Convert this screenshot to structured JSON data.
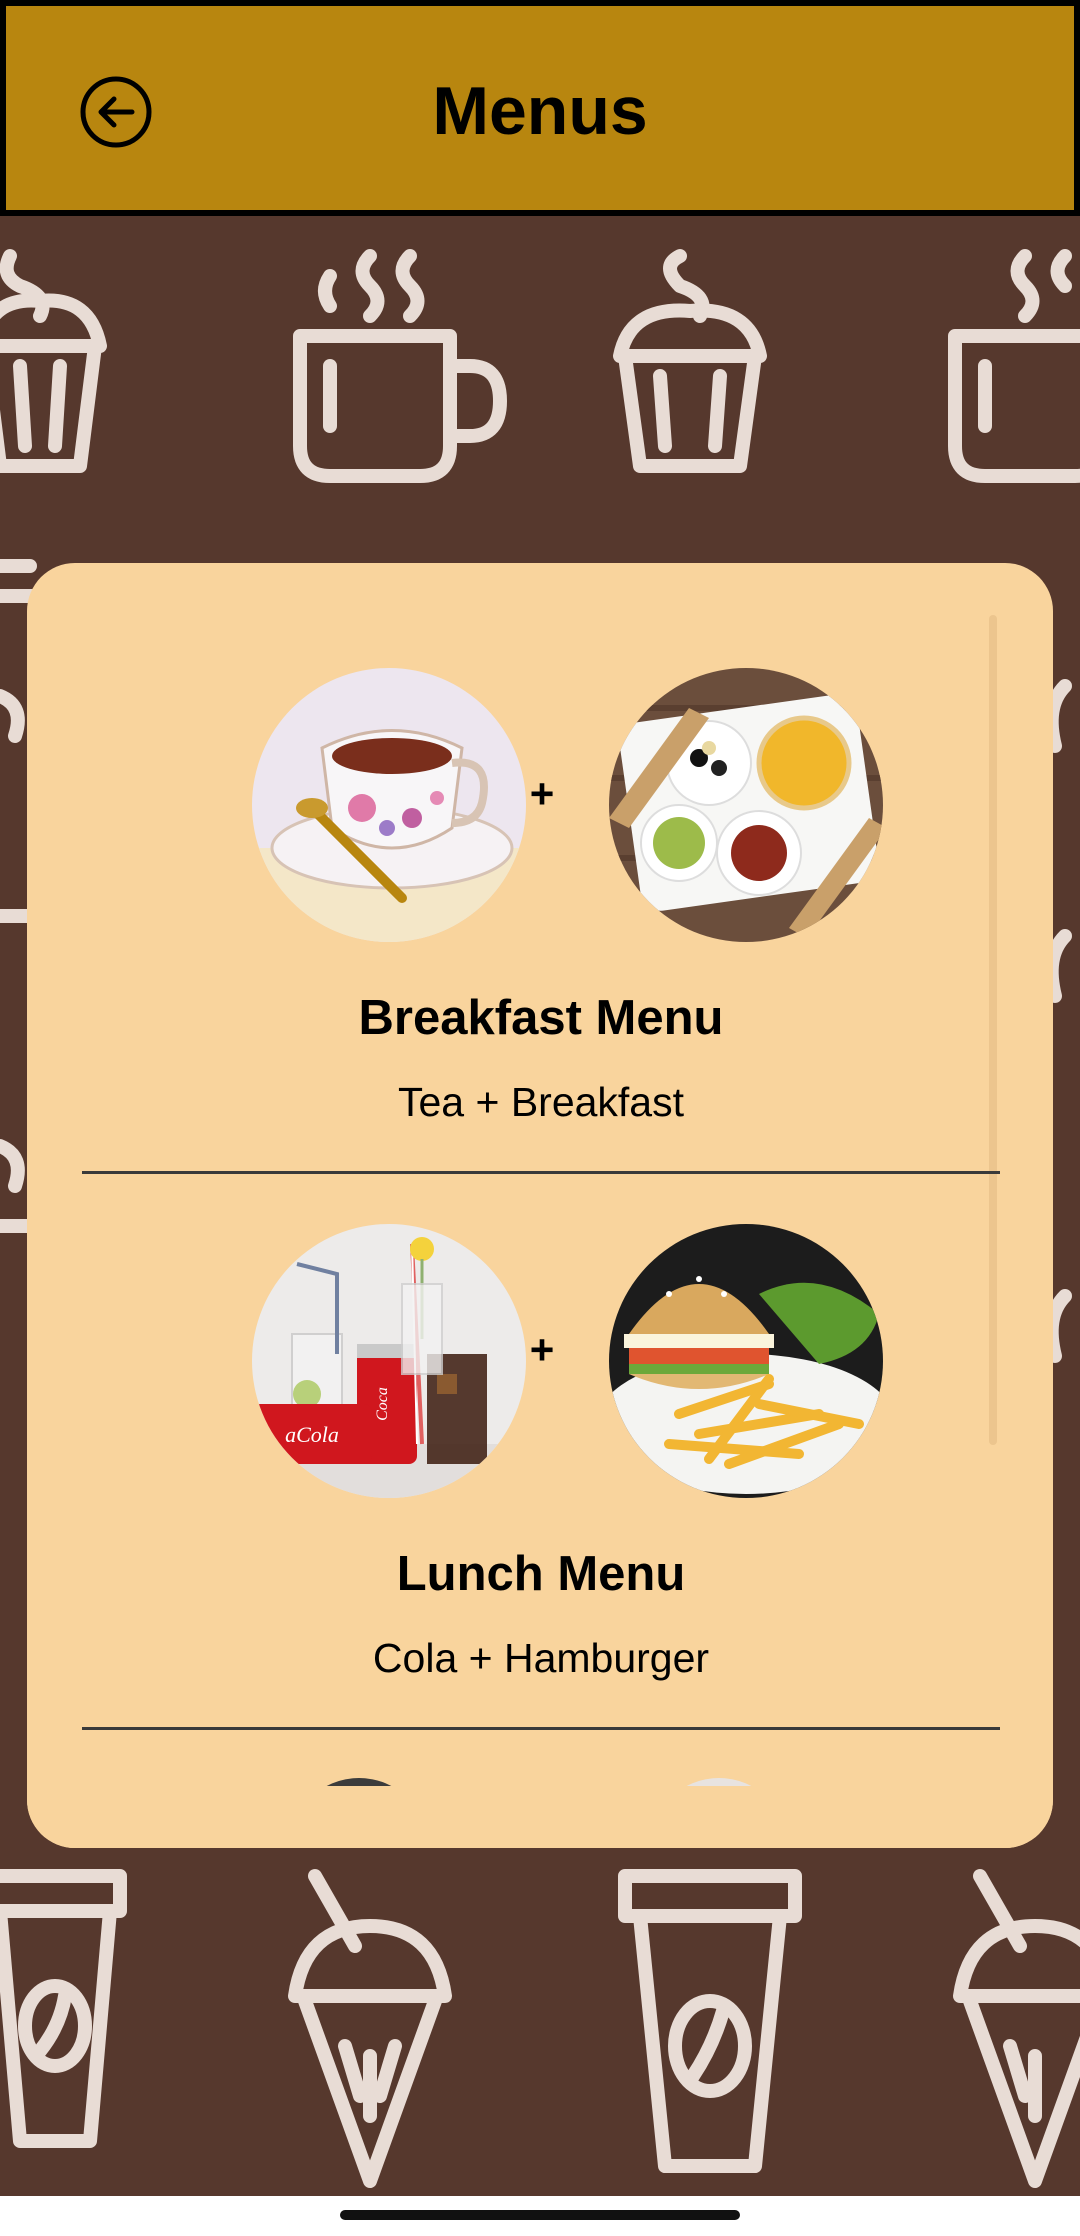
{
  "app_bar": {
    "title": "Menus",
    "back_icon": "arrow-left-circle-icon"
  },
  "colors": {
    "app_bar": "#B8860F",
    "background": "#56382D",
    "card": "#F9D49D",
    "pattern": "#E8DCD5"
  },
  "menus": [
    {
      "title": "Breakfast Menu",
      "subtitle": "Tea + Breakfast",
      "left_image": "tea-cup-photo",
      "right_image": "breakfast-plate-photo",
      "separator": "+"
    },
    {
      "title": "Lunch Menu",
      "subtitle": "Cola + Hamburger",
      "left_image": "cola-cans-photo",
      "right_image": "hamburger-fries-photo",
      "separator": "+"
    }
  ]
}
